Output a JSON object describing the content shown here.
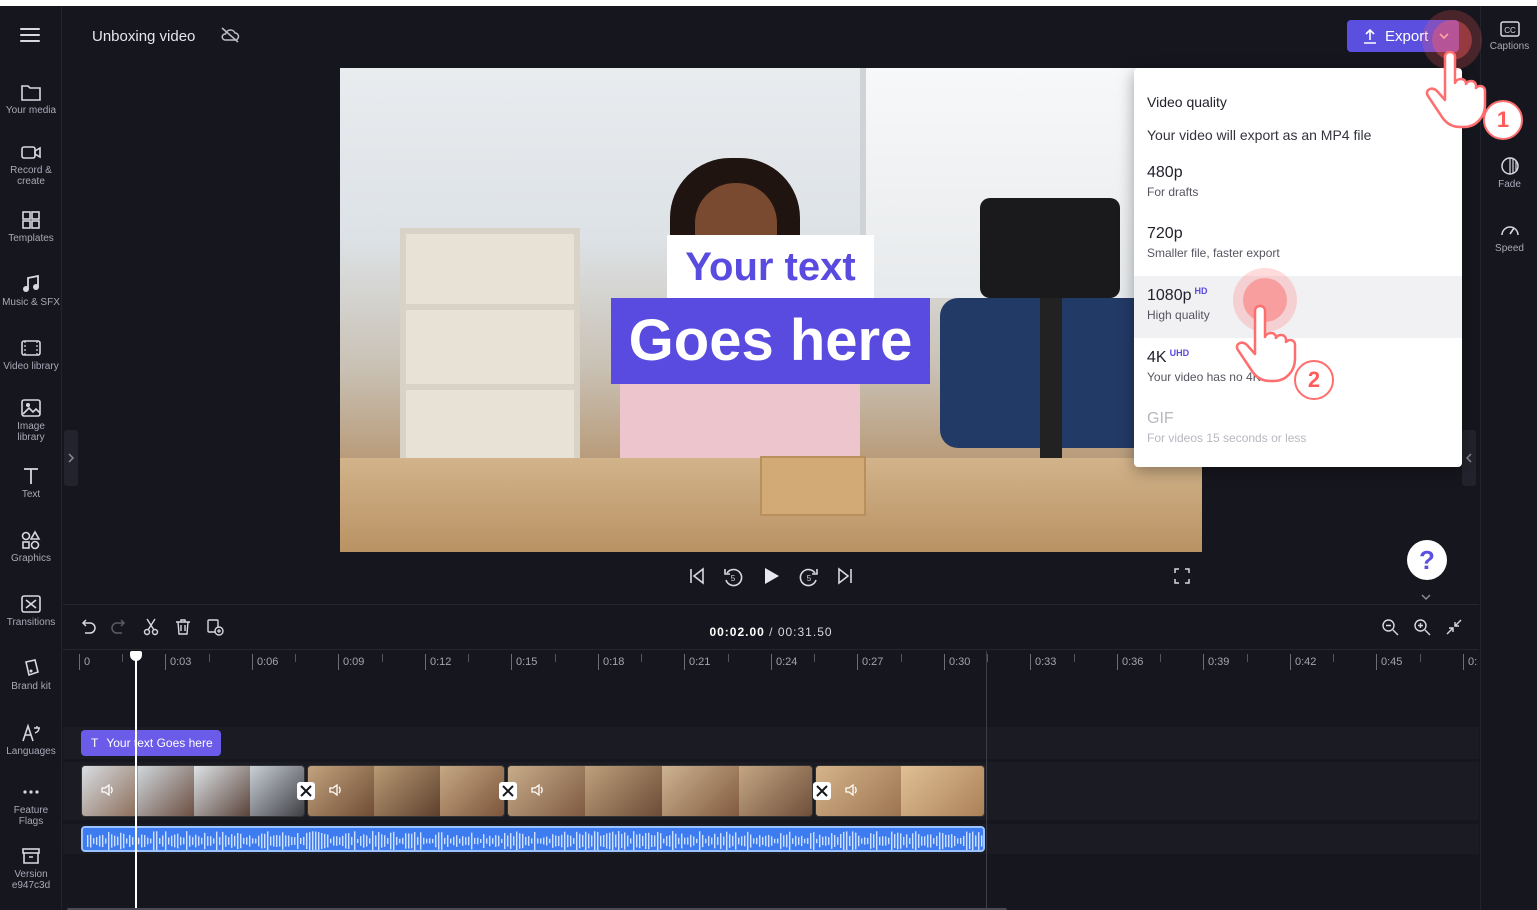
{
  "project": {
    "title": "Unboxing video"
  },
  "export_button": {
    "label": "Export"
  },
  "left_nav": [
    {
      "label": "Your media",
      "icon": "folder-icon"
    },
    {
      "label": "Record & create",
      "icon": "camera-icon"
    },
    {
      "label": "Templates",
      "icon": "templates-icon"
    },
    {
      "label": "Music & SFX",
      "icon": "music-icon"
    },
    {
      "label": "Video library",
      "icon": "film-icon"
    },
    {
      "label": "Image library",
      "icon": "image-icon"
    },
    {
      "label": "Text",
      "icon": "text-icon"
    },
    {
      "label": "Graphics",
      "icon": "shapes-icon"
    },
    {
      "label": "Transitions",
      "icon": "transitions-icon"
    },
    {
      "label": "Brand kit",
      "icon": "brand-kit-icon"
    },
    {
      "label": "Languages",
      "icon": "languages-icon"
    },
    {
      "label": "Feature Flags",
      "icon": "more-icon"
    },
    {
      "label": "Version e947c3d",
      "icon": "archive-icon"
    }
  ],
  "right_nav": [
    {
      "label": "Captions",
      "icon": "cc-icon"
    },
    {
      "label": "Fade",
      "icon": "fade-icon"
    },
    {
      "label": "Speed",
      "icon": "speed-icon"
    }
  ],
  "preview": {
    "text_line1": "Your text",
    "text_line2": "Goes here",
    "accent": "#5a4be0"
  },
  "export_menu": {
    "heading": "Video quality",
    "subheading": "Your video will export as an MP4 file",
    "options": [
      {
        "quality": "480p",
        "badge": "",
        "desc": "For drafts",
        "state": "normal"
      },
      {
        "quality": "720p",
        "badge": "",
        "desc": "Smaller file, faster export",
        "state": "normal"
      },
      {
        "quality": "1080p",
        "badge": "HD",
        "desc": "High quality",
        "state": "hover"
      },
      {
        "quality": "4K",
        "badge": "UHD",
        "desc": "Your video has no 4K",
        "state": "normal"
      },
      {
        "quality": "GIF",
        "badge": "",
        "desc": "For videos 15 seconds or less",
        "state": "disabled"
      }
    ]
  },
  "steps": {
    "one": "1",
    "two": "2"
  },
  "help": {
    "label": "?"
  },
  "timeline": {
    "current_time": "00:02.00",
    "total_time": "/ 00:31.50",
    "ruler_labels": [
      "0",
      "0:03",
      "0:06",
      "0:09",
      "0:12",
      "0:15",
      "0:18",
      "0:21",
      "0:24",
      "0:27",
      "0:30",
      "0:33",
      "0:36",
      "0:39",
      "0:42",
      "0:45",
      "0:"
    ],
    "text_clip_label": "Your text Goes here"
  },
  "colors": {
    "background": "#16161e",
    "accent": "#5b4fe0",
    "audio": "#3d7bf0",
    "tap": "#ff5a5a"
  }
}
